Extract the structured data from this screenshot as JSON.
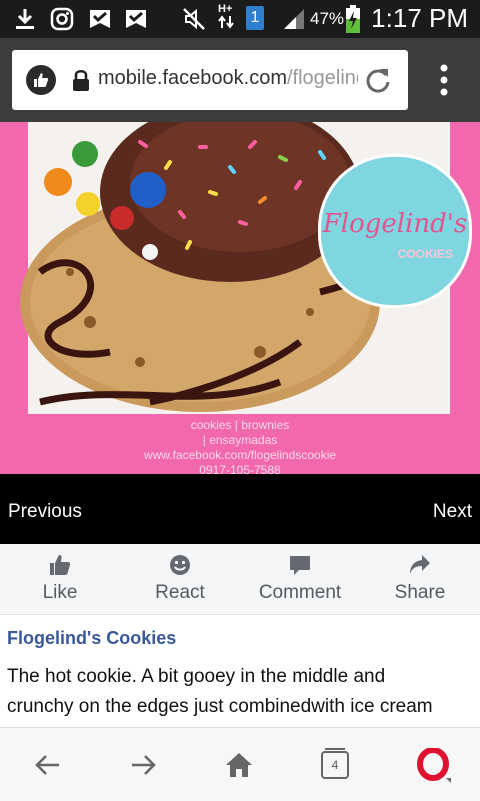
{
  "status_bar": {
    "time": "1:17 PM",
    "battery_percent": "47%",
    "sim_slot": "1",
    "network_type": "H+",
    "icons": [
      "download-icon",
      "instagram-icon",
      "check-badge-icon",
      "check-badge-icon",
      "mute-icon",
      "data-arrows-icon",
      "sim-icon",
      "signal-icon",
      "battery-charging-icon"
    ]
  },
  "browser": {
    "url_domain": "mobile.facebook.com",
    "url_path": "/flogelind",
    "site_icon": "thumbs-up-circle-icon",
    "reload_icon": "reload-icon",
    "menu_icon": "more-vertical-icon"
  },
  "photo": {
    "logo_text": "Flogelind's",
    "logo_subtext": "COOKIES",
    "caption_lines": [
      "cookies | brownies",
      "| ensaymadas",
      "www.facebook.com/flogelindscookie",
      "0917-105-7588"
    ],
    "background_color": "#f268ad"
  },
  "gallery_nav": {
    "previous_label": "Previous",
    "next_label": "Next"
  },
  "actions": [
    {
      "label": "Like",
      "icon": "like-icon"
    },
    {
      "label": "React",
      "icon": "smiley-icon"
    },
    {
      "label": "Comment",
      "icon": "comment-icon"
    },
    {
      "label": "Share",
      "icon": "share-icon"
    }
  ],
  "post": {
    "author": "Flogelind's Cookies",
    "body_lines": [
      "The hot cookie. A bit gooey in the middle and",
      "crunchy on the edges just combinedwith ice cream"
    ]
  },
  "bottom_nav": {
    "tab_count": "4",
    "icons": [
      "back-arrow-icon",
      "forward-arrow-icon",
      "home-icon",
      "tabs-icon",
      "opera-icon"
    ]
  },
  "colors": {
    "facebook_blue": "#3b5998",
    "opera_red": "#e0102f"
  }
}
